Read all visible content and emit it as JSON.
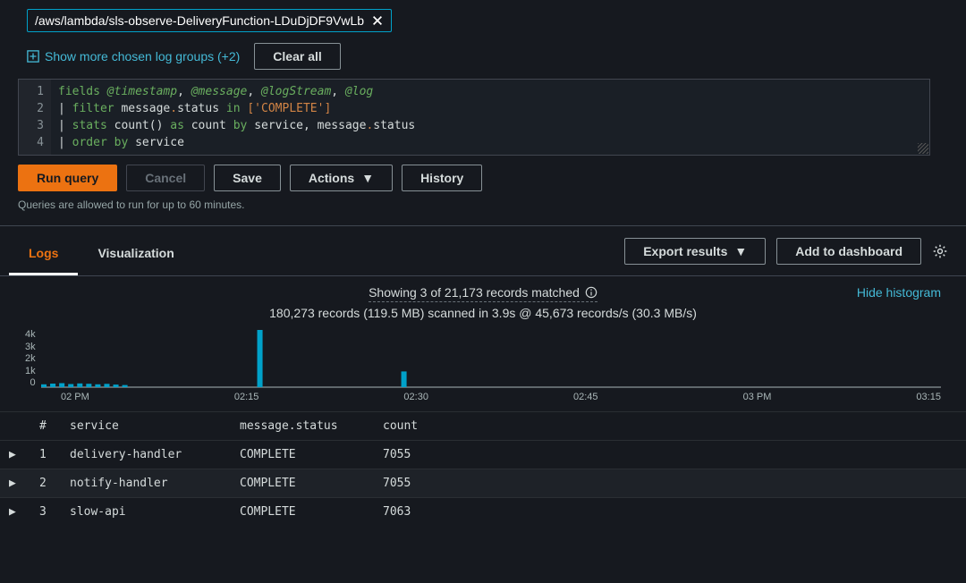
{
  "log_group": {
    "selected": "/aws/lambda/sls-observe-DeliveryFunction-LDuDjDF9VwLb",
    "show_more_label": "Show more chosen log groups (+2)",
    "clear_all_label": "Clear all"
  },
  "query_lines": {
    "l1_fields": "fields",
    "l1_ts": "@timestamp",
    "l1_msg": "@message",
    "l1_ls": "@logStream",
    "l1_log": "@log",
    "l2_filter": "filter",
    "l2_field": "message",
    "l2_dot": ".",
    "l2_sub": "status",
    "l2_in": "in",
    "l2_val": "['COMPLETE']",
    "l3_stats": "stats",
    "l3_count_fn": "count()",
    "l3_as": "as",
    "l3_alias": "count",
    "l3_by": "by",
    "l3_g1": "service",
    "l3_g2": "message",
    "l3_g2b": "status",
    "l4_order": "order",
    "l4_by": "by",
    "l4_field": "service"
  },
  "buttons": {
    "run": "Run query",
    "cancel": "Cancel",
    "save": "Save",
    "actions": "Actions",
    "history": "History",
    "export": "Export results",
    "add_dash": "Add to dashboard"
  },
  "hint": "Queries are allowed to run for up to 60 minutes.",
  "tabs": {
    "logs": "Logs",
    "visualization": "Visualization"
  },
  "summary": {
    "line1": "Showing 3 of 21,173 records matched",
    "line2": "180,273 records (119.5 MB) scanned in 3.9s @ 45,673 records/s (30.3 MB/s)",
    "hide": "Hide histogram"
  },
  "chart_data": {
    "type": "bar",
    "y_ticks": [
      "4k",
      "3k",
      "2k",
      "1k",
      "0"
    ],
    "x_ticks": [
      "02 PM",
      "02:15",
      "02:30",
      "02:45",
      "03 PM",
      "03:15"
    ],
    "ylim": [
      0,
      4000
    ],
    "bars": [
      {
        "x_frac": 0.0,
        "value": 200
      },
      {
        "x_frac": 0.01,
        "value": 250
      },
      {
        "x_frac": 0.02,
        "value": 280
      },
      {
        "x_frac": 0.03,
        "value": 220
      },
      {
        "x_frac": 0.04,
        "value": 260
      },
      {
        "x_frac": 0.05,
        "value": 240
      },
      {
        "x_frac": 0.06,
        "value": 200
      },
      {
        "x_frac": 0.07,
        "value": 230
      },
      {
        "x_frac": 0.08,
        "value": 180
      },
      {
        "x_frac": 0.09,
        "value": 150
      },
      {
        "x_frac": 0.24,
        "value": 4000
      },
      {
        "x_frac": 0.4,
        "value": 1100
      }
    ]
  },
  "table": {
    "headers": {
      "idx": "#",
      "service": "service",
      "status": "message.status",
      "count": "count"
    },
    "rows": [
      {
        "idx": "1",
        "service": "delivery-handler",
        "status": "COMPLETE",
        "count": "7055"
      },
      {
        "idx": "2",
        "service": "notify-handler",
        "status": "COMPLETE",
        "count": "7055"
      },
      {
        "idx": "3",
        "service": "slow-api",
        "status": "COMPLETE",
        "count": "7063"
      }
    ]
  }
}
